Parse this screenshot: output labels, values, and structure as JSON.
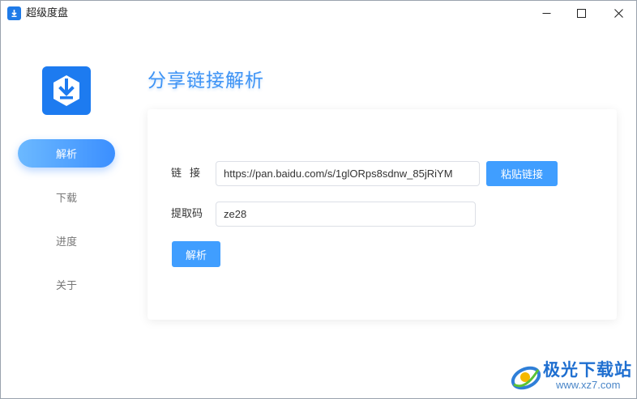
{
  "window": {
    "title": "超级度盘",
    "minimize_icon": "minimize-icon",
    "maximize_icon": "maximize-icon",
    "close_icon": "close-icon"
  },
  "sidebar": {
    "logo_icon": "download-shield-icon",
    "items": [
      {
        "label": "解析",
        "active": true
      },
      {
        "label": "下载",
        "active": false
      },
      {
        "label": "进度",
        "active": false
      },
      {
        "label": "关于",
        "active": false
      }
    ]
  },
  "main": {
    "title": "分享链接解析",
    "link_label": "链接",
    "link_value": "https://pan.baidu.com/s/1glORps8sdnw_85jRiYM",
    "paste_button": "粘贴链接",
    "code_label": "提取码",
    "code_value": "ze28",
    "parse_button": "解析"
  },
  "watermark": {
    "name": "极光下载站",
    "url": "www.xz7.com"
  },
  "colors": {
    "accent": "#409eff",
    "title_blue": "#3d93f5",
    "logo_blue": "#1d7bf0"
  }
}
